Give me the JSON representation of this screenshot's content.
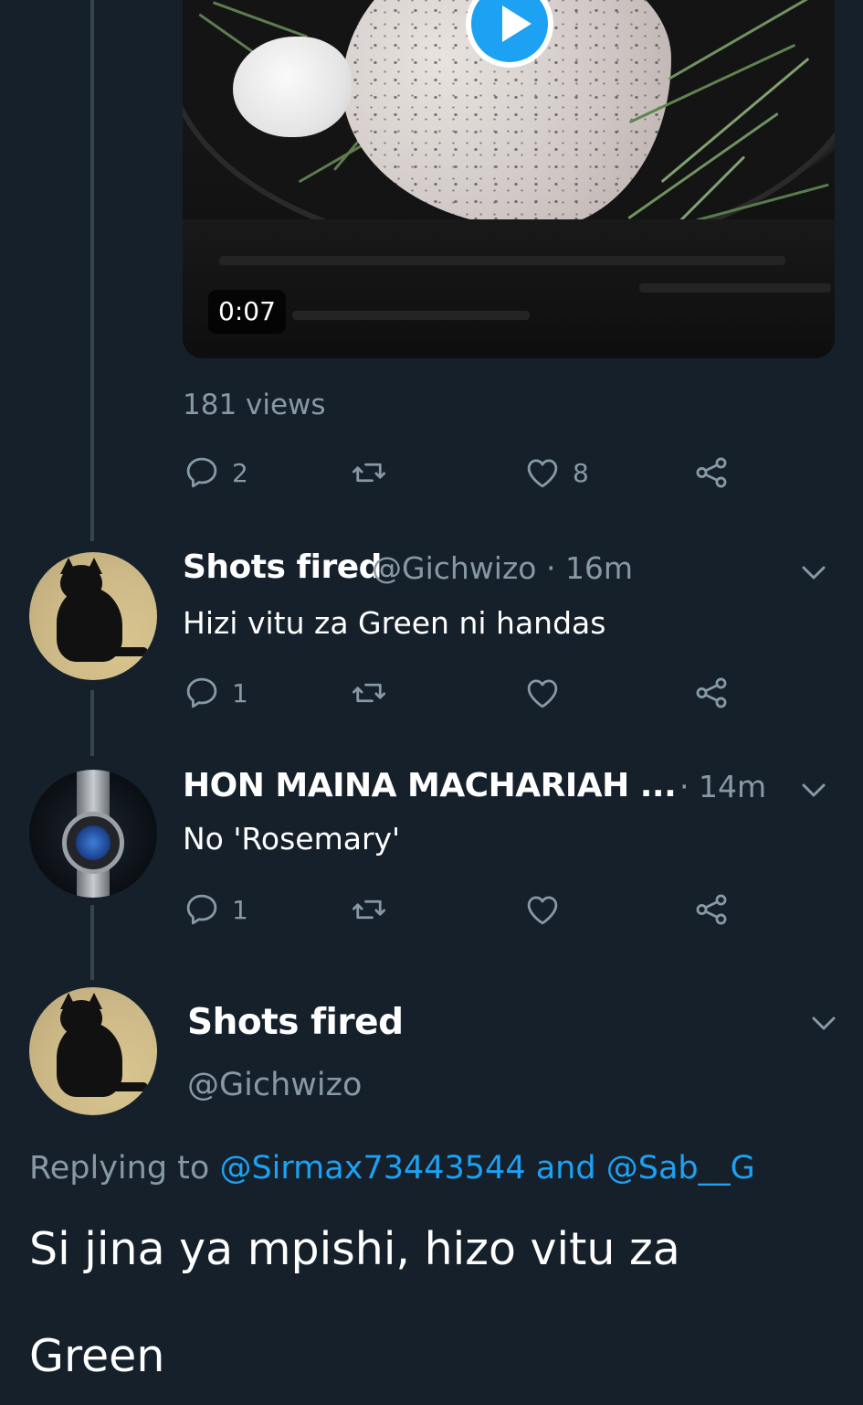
{
  "video": {
    "duration": "0:07",
    "views": "181 views",
    "play_icon": "play-icon"
  },
  "original_tweet_actions": {
    "reply_count": "2",
    "retweet_count": "",
    "like_count": "8"
  },
  "replies": [
    {
      "display_name": "Shots fired",
      "handle_time": "@Gichwizo · 16m",
      "text": "Hizi vitu za Green ni handas",
      "reply_count": "1",
      "like_count": ""
    },
    {
      "display_name": "HON MAINA MACHARIAH ...",
      "handle_time": "· 14m",
      "text": "No 'Rosemary'",
      "reply_count": "1",
      "like_count": ""
    }
  ],
  "focused_tweet": {
    "display_name": "Shots fired",
    "handle": "@Gichwizo",
    "replying_prefix": "Replying to",
    "mention_1": "@Sirmax73443544",
    "and_word": "and",
    "mention_2": "@Sab__G",
    "text_line_1": "Si jina ya mpishi, hizo vitu za",
    "text_line_2": "Green"
  },
  "colors": {
    "background": "#15202b",
    "accent": "#1da1f2",
    "secondary_text": "#8899a6",
    "thread_line": "#38444d"
  }
}
